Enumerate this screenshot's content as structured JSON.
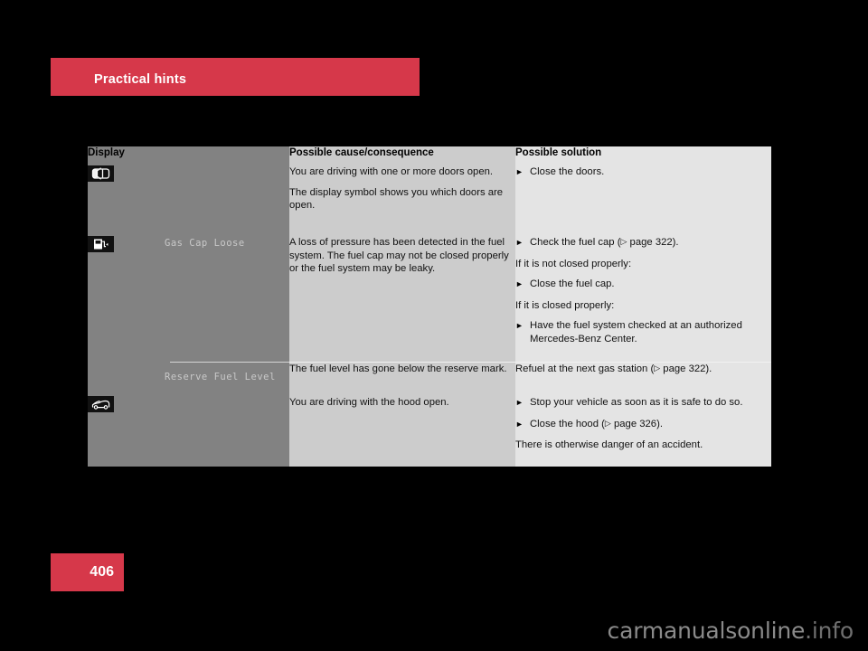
{
  "header": {
    "chapter_title": "Practical hints"
  },
  "table": {
    "columns": [
      {
        "key": "display",
        "label": "Display"
      },
      {
        "key": "cause",
        "label": "Possible cause/consequence"
      },
      {
        "key": "solution",
        "label": "Possible solution"
      }
    ],
    "rows": [
      {
        "icon": "car-doors-open-icon",
        "display_text": "",
        "cause": [
          "You are driving with one or more doors open.",
          "The display symbol shows you which doors are open."
        ],
        "solution_items": [
          {
            "type": "bullet",
            "text": "Close the doors."
          }
        ]
      },
      {
        "icon": "fuel-pump-icon",
        "display_text": "Gas Cap Loose",
        "cause": [
          "A loss of pressure has been detected in the fuel system. The fuel cap may not be closed properly or the fuel system may be leaky."
        ],
        "solution_items": [
          {
            "type": "bullet",
            "text": "Check the fuel cap (",
            "ref": "page 322",
            "tail": ")."
          },
          {
            "type": "para",
            "text": "If it is not closed properly:"
          },
          {
            "type": "bullet",
            "text": "Close the fuel cap."
          },
          {
            "type": "para",
            "text": "If it is closed properly:"
          },
          {
            "type": "bullet",
            "text": "Have the fuel system checked at an authorized Mercedes-Benz Center."
          }
        ]
      },
      {
        "subrow": true,
        "icon": "",
        "display_text": "Reserve Fuel Level",
        "cause": [
          "The fuel level has gone below the reserve mark."
        ],
        "solution_items": [
          {
            "type": "para",
            "text": "Refuel at the next gas station (",
            "ref": "page 322",
            "tail": ")."
          }
        ]
      },
      {
        "icon": "car-hood-open-icon",
        "display_text": "",
        "cause": [
          "You are driving with the hood open."
        ],
        "solution_items": [
          {
            "type": "bullet",
            "text": "Stop your vehicle as soon as it is safe to do so."
          },
          {
            "type": "bullet",
            "text": "Close the hood (",
            "ref": "page 326",
            "tail": ")."
          },
          {
            "type": "para",
            "text": "There is otherwise danger of an accident."
          }
        ]
      }
    ]
  },
  "footer": {
    "page_number": "406"
  },
  "watermark": {
    "text_main": "carmanualsonline",
    "text_suffix": ".info"
  },
  "colors": {
    "accent_red": "#d6384a",
    "page_background": "#000000",
    "col_display_bg": "#828282",
    "col_cause_bg": "#cccccc",
    "col_solution_bg": "#e4e4e4"
  }
}
